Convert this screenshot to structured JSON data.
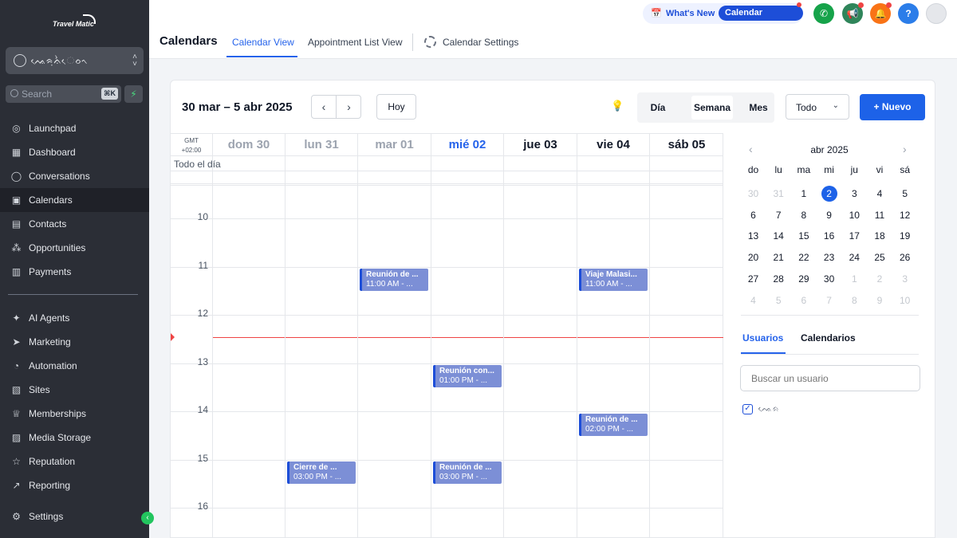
{
  "sidebar": {
    "logo_text": "Travel Matic",
    "account_name": "ᨕᨙᨑᨘᨊᨛᨙᨔᨚ",
    "search_placeholder": "Search",
    "search_shortcut": "⌘K",
    "nav_items": [
      {
        "label": "Launchpad",
        "icon": "rocket-icon"
      },
      {
        "label": "Dashboard",
        "icon": "grid-icon"
      },
      {
        "label": "Conversations",
        "icon": "chat-icon"
      },
      {
        "label": "Calendars",
        "icon": "calendar-icon",
        "active": true
      },
      {
        "label": "Contacts",
        "icon": "contacts-icon"
      },
      {
        "label": "Opportunities",
        "icon": "opportunities-icon"
      },
      {
        "label": "Payments",
        "icon": "payments-icon"
      },
      {
        "label": "AI Agents",
        "icon": "sparkle-icon"
      },
      {
        "label": "Marketing",
        "icon": "send-icon"
      },
      {
        "label": "Automation",
        "icon": "automation-icon"
      },
      {
        "label": "Sites",
        "icon": "sites-icon"
      },
      {
        "label": "Memberships",
        "icon": "memberships-icon"
      },
      {
        "label": "Media Storage",
        "icon": "media-icon"
      },
      {
        "label": "Reputation",
        "icon": "star-icon"
      },
      {
        "label": "Reporting",
        "icon": "trend-icon"
      },
      {
        "label": "Settings",
        "icon": "gear-icon"
      }
    ]
  },
  "topbar": {
    "whats_new": "What's New",
    "updates_pill": "Calendar Updates",
    "page_title": "Calendars",
    "tabs": [
      "Calendar View",
      "Appointment List View",
      "Calendar Settings"
    ],
    "active_tab": "Calendar View",
    "help_label": "?"
  },
  "colors": {
    "accent": "#1d62e8",
    "event_bg": "#7c8fd6",
    "event_border": "#1d4ed8",
    "now_line": "#ef4444",
    "phone_btn": "#16a34a",
    "megaphone_btn": "#2f855a",
    "bell_btn": "#f97316",
    "help_btn": "#2b7de9"
  },
  "toolbar": {
    "date_range": "30 mar – 5 abr 2025",
    "today_label": "Hoy",
    "views": [
      "Día",
      "Semana",
      "Mes"
    ],
    "active_view": "Semana",
    "filter_value": "Todo",
    "new_label": "+ Nuevo"
  },
  "week": {
    "gmt_label": "GMT",
    "gmt_offset": "+02:00",
    "allday_label": "Todo el día",
    "days": [
      {
        "label": "dom 30",
        "state": "past"
      },
      {
        "label": "lun 31",
        "state": "past"
      },
      {
        "label": "mar 01",
        "state": "past"
      },
      {
        "label": "mié 02",
        "state": "current"
      },
      {
        "label": "jue 03",
        "state": "future"
      },
      {
        "label": "vie 04",
        "state": "future"
      },
      {
        "label": "sáb 05",
        "state": "future"
      }
    ],
    "hours": [
      "10",
      "11",
      "12",
      "13",
      "14",
      "15",
      "16"
    ],
    "events": [
      {
        "day": 2,
        "hour": 11,
        "title": "Reunión de ...",
        "time": "11:00 AM - ..."
      },
      {
        "day": 5,
        "hour": 11,
        "title": "Viaje Malasi...",
        "time": "11:00 AM - ..."
      },
      {
        "day": 3,
        "hour": 13,
        "title": "Reunión con...",
        "time": "01:00 PM - ..."
      },
      {
        "day": 5,
        "hour": 14,
        "title": "Reunión de ...",
        "time": "02:00 PM - ..."
      },
      {
        "day": 1,
        "hour": 15,
        "title": "Cierre de ...",
        "time": "03:00 PM - ..."
      },
      {
        "day": 3,
        "hour": 15,
        "title": "Reunión de ...",
        "time": "03:00 PM - ..."
      }
    ]
  },
  "mini_calendar": {
    "month_label": "abr 2025",
    "weekdays": [
      "do",
      "lu",
      "ma",
      "mi",
      "ju",
      "vi",
      "sá"
    ],
    "weeks": [
      [
        "30",
        "31",
        "1",
        "2",
        "3",
        "4",
        "5"
      ],
      [
        "6",
        "7",
        "8",
        "9",
        "10",
        "11",
        "12"
      ],
      [
        "13",
        "14",
        "15",
        "16",
        "17",
        "18",
        "19"
      ],
      [
        "20",
        "21",
        "22",
        "23",
        "24",
        "25",
        "26"
      ],
      [
        "27",
        "28",
        "29",
        "30",
        "1",
        "2",
        "3"
      ],
      [
        "4",
        "5",
        "6",
        "7",
        "8",
        "9",
        "10"
      ]
    ],
    "selected": "2"
  },
  "users_panel": {
    "tabs": [
      "Usuarios",
      "Calendarios"
    ],
    "active_tab": "Usuarios",
    "search_placeholder": "Buscar un usuario",
    "user_name": "ᨕᨙᨑ"
  }
}
